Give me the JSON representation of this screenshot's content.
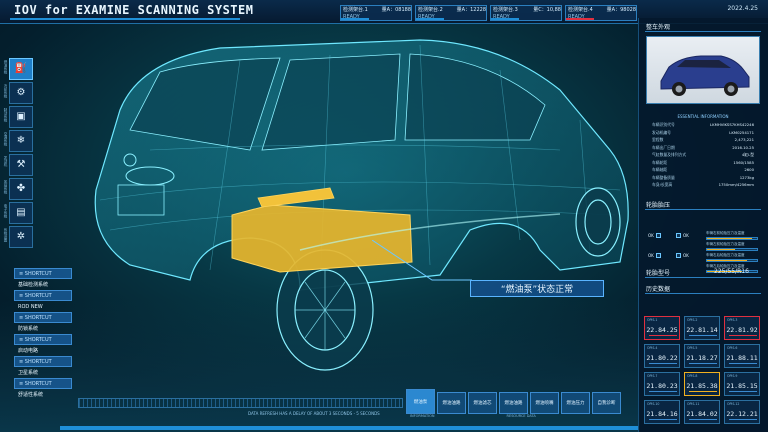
{
  "header": {
    "title": "IOV for EXAMINE SCANNING SYSTEM",
    "date": "2022.4.25",
    "stations": [
      {
        "name": "检测架台.1",
        "metric": "量A：08188",
        "status": "READY",
        "bar_color": "#1f8fd8"
      },
      {
        "name": "检测架台.2",
        "metric": "量A：12228",
        "status": "READY",
        "bar_color": "#1f8fd8"
      },
      {
        "name": "检测架台.3",
        "metric": "量C：10,88",
        "status": "READY",
        "bar_color": "#1f8fd8"
      },
      {
        "name": "检测架台.4",
        "metric": "量A：98028",
        "status": "READY",
        "bar_color": "#e03040"
      }
    ]
  },
  "sidebar": {
    "items": [
      {
        "label": "燃油系统",
        "icon": "fuel-icon",
        "active": true
      },
      {
        "label": "冷却系统",
        "icon": "gear-icon",
        "active": false
      },
      {
        "label": "制动系统",
        "icon": "chip-icon",
        "active": false
      },
      {
        "label": "空调系统",
        "icon": "snowflake-icon",
        "active": false
      },
      {
        "label": "发动机",
        "icon": "engine-icon",
        "active": false
      },
      {
        "label": "风扇系统",
        "icon": "fan-icon",
        "active": false
      },
      {
        "label": "电子系统",
        "icon": "document-icon",
        "active": false
      },
      {
        "label": "系统设置",
        "icon": "settings-icon",
        "active": false
      }
    ]
  },
  "left_list": [
    {
      "label": "≡ SHORTCUT",
      "type": "shortcut"
    },
    {
      "label": "基础检测系统",
      "type": "plain"
    },
    {
      "label": "≡ SHORTCUT",
      "type": "shortcut"
    },
    {
      "label": "ROD NEW",
      "type": "plain"
    },
    {
      "label": "≡ SHORTCUT",
      "type": "shortcut"
    },
    {
      "label": "防锁系统",
      "type": "plain"
    },
    {
      "label": "≡ SHORTCUT",
      "type": "shortcut"
    },
    {
      "label": "启动电路",
      "type": "plain"
    },
    {
      "label": "≡ SHORTCUT",
      "type": "shortcut"
    },
    {
      "label": "卫星系统",
      "type": "plain"
    },
    {
      "label": "≡ SHORTCUT",
      "type": "shortcut"
    },
    {
      "label": "舒适性系统",
      "type": "plain"
    }
  ],
  "callout": "“燃油泵”状态正常",
  "bottom_note": "DATA REFRESH HAS A DELAY OF ABOUT 3 SECONDS - 5 SECONDS",
  "footer": {
    "tabs": [
      {
        "label": "燃油泵",
        "active": true
      },
      {
        "label": "燃油油路",
        "active": false
      },
      {
        "label": "燃油滤芯",
        "active": false
      },
      {
        "label": "燃油油路",
        "active": false
      },
      {
        "label": "燃油喷嘴",
        "active": false
      },
      {
        "label": "燃油压力",
        "active": false
      },
      {
        "label": "自我诊断",
        "active": false
      }
    ],
    "sub_labels": [
      "INFORMATION",
      "RESOURCE DATA"
    ]
  },
  "right_panel": {
    "car_title": "整车外观",
    "info_header": "ESSENTIAL INFORMATION",
    "info_rows": [
      {
        "k": "车辆识别代号",
        "v": "LKMHVIKSS7KHS42246"
      },
      {
        "k": "发动机编号",
        "v": "LKM0254171"
      },
      {
        "k": "里程数",
        "v": "2,473,221"
      },
      {
        "k": "车辆出厂日期",
        "v": "2016.10.25"
      },
      {
        "k": "气缸数量及排列方式",
        "v": "4缸L型"
      },
      {
        "k": "车辆轮距",
        "v": "1560/1585"
      },
      {
        "k": "车辆轴距",
        "v": "2600"
      },
      {
        "k": "车辆整备质量",
        "v": "1273kg"
      },
      {
        "k": "车身/长宽高",
        "v": "1750mm/4256mm"
      }
    ],
    "tire_title": "轮胎胎压",
    "tire_states": [
      {
        "label": "OK"
      },
      {
        "label": "OK"
      },
      {
        "label": "OK"
      },
      {
        "label": "OK"
      }
    ],
    "tire_bars": [
      {
        "text": "车辆右前轮胎压力及温度",
        "fill": 0.9
      },
      {
        "text": "车辆左前轮胎压力及温度",
        "fill": 0.55
      },
      {
        "text": "车辆右后轮胎压力及温度",
        "fill": 0.8
      },
      {
        "text": "车辆左后轮胎压力及温度",
        "fill": 0.7
      }
    ],
    "tire_model_label": "轮胎型号",
    "tire_model": "225/55/R16",
    "history_title": "历史数据",
    "history": [
      {
        "label": "OPIS.1",
        "value": "22.84.25",
        "style": "red"
      },
      {
        "label": "OPIS.2",
        "value": "22.81.14",
        "style": "normal"
      },
      {
        "label": "OPIS.3",
        "value": "22.81.92",
        "style": "red"
      },
      {
        "label": "OPIS.4",
        "value": "21.80.22",
        "style": "normal"
      },
      {
        "label": "OPIS.5",
        "value": "21.18.27",
        "style": "normal"
      },
      {
        "label": "OPIS.6",
        "value": "21.88.11",
        "style": "normal"
      },
      {
        "label": "OPIS.7",
        "value": "21.80.23",
        "style": "normal"
      },
      {
        "label": "OPIS.8",
        "value": "21.85.38",
        "style": "gold"
      },
      {
        "label": "OPIS.9",
        "value": "21.85.15",
        "style": "normal"
      },
      {
        "label": "OPIS.10",
        "value": "21.84.16",
        "style": "normal"
      },
      {
        "label": "OPIS.11",
        "value": "21.84.02",
        "style": "normal"
      },
      {
        "label": "OPIS.12",
        "value": "22.12.21",
        "style": "normal"
      }
    ]
  }
}
